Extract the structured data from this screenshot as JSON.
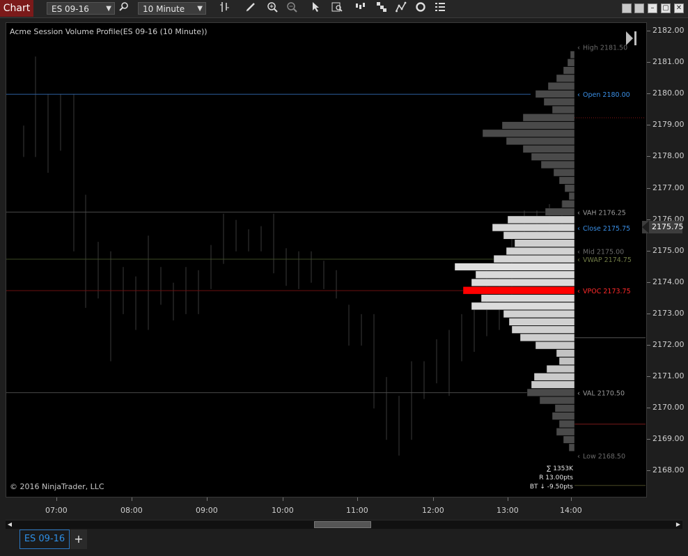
{
  "toolbar": {
    "brand": "Chart",
    "instrument": "ES 09-16",
    "interval": "10 Minute",
    "icons": [
      "search-icon",
      "bar-type-icon",
      "pencil-icon",
      "zoom-in-icon",
      "zoom-out-icon",
      "pointer-icon",
      "data-box-icon",
      "chart-trader-icon",
      "strategy-icon",
      "indicator-icon",
      "reload-icon",
      "properties-icon"
    ]
  },
  "window": {
    "controls": [
      "minimize",
      "maximize-small",
      "maximize",
      "close"
    ]
  },
  "chart": {
    "title": "Acme Session Volume Profile(ES 09-16 (10 Minute))",
    "copyright": "© 2016 NinjaTrader, LLC",
    "current_price": "2175.75",
    "stats": {
      "total": "∑ 1353K",
      "range": "R 13.00pts",
      "bt": "BT ↓ -9.50pts"
    },
    "levels": [
      {
        "name": "high",
        "text": "High 2181.50",
        "color": "#6a6a6a"
      },
      {
        "name": "open",
        "text": "Open 2180.00",
        "color": "#3a8fe6"
      },
      {
        "name": "vah",
        "text": "VAH 2176.25",
        "color": "#9a9a9a"
      },
      {
        "name": "close",
        "text": "Close 2175.75",
        "color": "#3a8fe6"
      },
      {
        "name": "mid",
        "text": "Mid 2175.00",
        "color": "#6a6a6a"
      },
      {
        "name": "vwap",
        "text": "VWAP 2174.75",
        "color": "#6f7a45"
      },
      {
        "name": "vpoc",
        "text": "VPOC 2173.75",
        "color": "#ff2a2a"
      },
      {
        "name": "val",
        "text": "VAL 2170.50",
        "color": "#9a9a9a"
      },
      {
        "name": "low",
        "text": "Low 2168.50",
        "color": "#6a6a6a"
      }
    ]
  },
  "y_axis": {
    "labels": [
      "2182.00",
      "2181.00",
      "2180.00",
      "2179.00",
      "2178.00",
      "2177.00",
      "2176.00",
      "2175.00",
      "2174.00",
      "2173.00",
      "2172.00",
      "2171.00",
      "2170.00",
      "2169.00",
      "2168.00"
    ]
  },
  "x_axis": {
    "labels": [
      "07:00",
      "08:00",
      "09:00",
      "10:00",
      "11:00",
      "12:00",
      "13:00",
      "14:00"
    ]
  },
  "tabs": [
    {
      "label": "ES 09-16",
      "active": true
    }
  ],
  "add_tab": "+",
  "chart_data": {
    "type": "bar",
    "title": "Acme Session Volume Profile(ES 09-16 (10 Minute))",
    "xlabel": "",
    "ylabel": "",
    "ylim": [
      2167.5,
      2182.25
    ],
    "price_bins": [
      2181.25,
      2181.0,
      2180.75,
      2180.5,
      2180.25,
      2180.0,
      2179.75,
      2179.5,
      2179.25,
      2179.0,
      2178.75,
      2178.5,
      2178.25,
      2178.0,
      2177.75,
      2177.5,
      2177.25,
      2177.0,
      2176.75,
      2176.5,
      2176.25,
      2176.0,
      2175.75,
      2175.5,
      2175.25,
      2175.0,
      2174.75,
      2174.5,
      2174.25,
      2174.0,
      2173.75,
      2173.5,
      2173.25,
      2173.0,
      2172.75,
      2172.5,
      2172.25,
      2172.0,
      2171.75,
      2171.5,
      2171.25,
      2171.0,
      2170.75,
      2170.5,
      2170.25,
      2170.0,
      2169.75,
      2169.5,
      2169.25,
      2169.0,
      2168.75
    ],
    "volume_rel": [
      0.03,
      0.05,
      0.08,
      0.13,
      0.19,
      0.28,
      0.22,
      0.16,
      0.37,
      0.52,
      0.66,
      0.49,
      0.37,
      0.31,
      0.24,
      0.15,
      0.11,
      0.07,
      0.04,
      0.09,
      0.21,
      0.48,
      0.59,
      0.51,
      0.43,
      0.49,
      0.58,
      0.86,
      0.71,
      0.74,
      0.8,
      0.67,
      0.74,
      0.51,
      0.47,
      0.45,
      0.39,
      0.28,
      0.13,
      0.11,
      0.2,
      0.29,
      0.31,
      0.34,
      0.25,
      0.14,
      0.16,
      0.11,
      0.13,
      0.08,
      0.04
    ]
  }
}
